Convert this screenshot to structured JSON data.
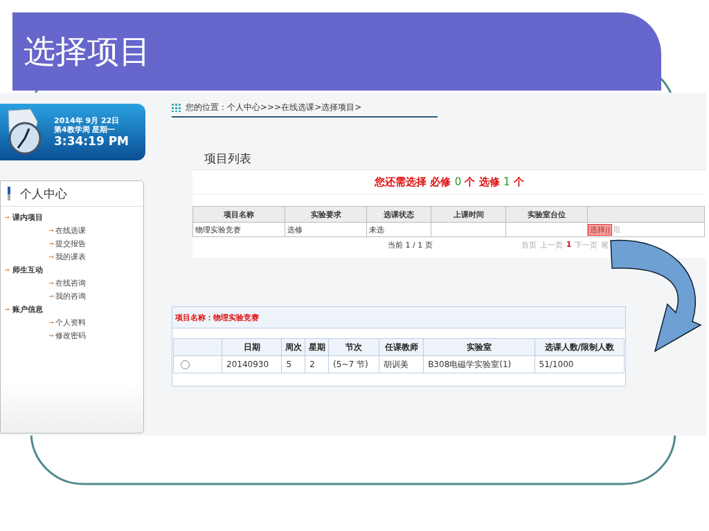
{
  "slide_title": "选择项目",
  "clock": {
    "date": "2014年 9月 22日",
    "week": "第4教学周 星期一",
    "time": "3:34:19 PM"
  },
  "sidebar": {
    "title": "个人中心",
    "groups": [
      {
        "label": "课内项目",
        "children": [
          {
            "label": "在线选课"
          },
          {
            "label": "提交报告"
          },
          {
            "label": "我的课表"
          }
        ]
      },
      {
        "label": "师生互动",
        "children": [
          {
            "label": "在线咨询"
          },
          {
            "label": "我的咨询"
          }
        ]
      },
      {
        "label": "账户信息",
        "children": [
          {
            "label": "个人资料"
          },
          {
            "label": "修改密码"
          }
        ]
      }
    ]
  },
  "breadcrumb": "您的位置：个人中心>>>在线选课>选择项目>",
  "list_title": "项目列表",
  "notice_parts": [
    {
      "text": "您还需选择 必修 ",
      "kind": "red"
    },
    {
      "text": "0",
      "kind": "green"
    },
    {
      "text": " 个 选修 ",
      "kind": "red"
    },
    {
      "text": "1",
      "kind": "green"
    },
    {
      "text": " 个",
      "kind": "red"
    }
  ],
  "projects_table": {
    "columns": [
      "项目名称",
      "实验要求",
      "选课状态",
      "上课时间",
      "实验室台位"
    ],
    "rows": [
      {
        "cells": [
          "物理实验竞赛",
          "选修",
          "未选",
          "",
          ""
        ],
        "select": "选择||",
        "cancel": "取"
      }
    ]
  },
  "pagination": {
    "current": "当前 1 / 1 页",
    "links": [
      {
        "label": "首页",
        "selected": false
      },
      {
        "label": "上一页",
        "selected": false
      },
      {
        "label": "1",
        "selected": true
      },
      {
        "label": "下一页",
        "selected": false
      },
      {
        "label": "尾",
        "selected": false
      }
    ]
  },
  "detail": {
    "title": "项目名称：物理实验竞赛",
    "columns": [
      "日期",
      "周次",
      "星期",
      "节次",
      "任课教师",
      "实验室",
      "选课人数/限制人数"
    ],
    "rows": [
      {
        "selected": false,
        "cells": [
          "20140930",
          "5",
          "2",
          "(5~7 节)",
          "胡训美",
          "B308电磁学实验室(1)",
          "51/1000"
        ]
      }
    ]
  }
}
